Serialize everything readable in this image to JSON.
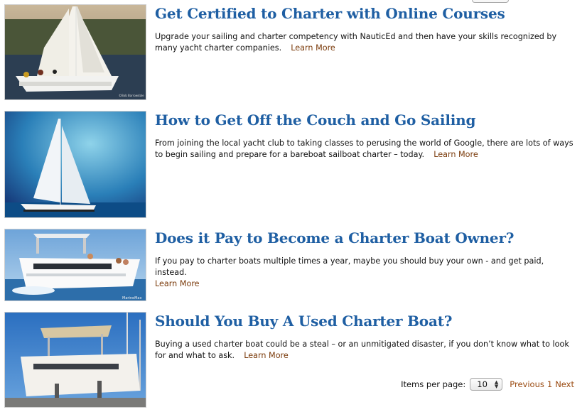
{
  "articles": [
    {
      "title": "Get Certified to Charter with Online Courses",
      "description": "Upgrade your sailing and charter competency with NauticEd and then have your skills recognized by many yacht charter companies.",
      "learn_more": "Learn More",
      "photo_credit": "©Bob Barrowdale"
    },
    {
      "title": "How to Get Off the Couch and Go Sailing",
      "description": "From joining the local yacht club to taking classes to perusing the world of Google, there are lots of ways to begin sailing and prepare for a bareboat sailboat charter – today.",
      "learn_more": "Learn More"
    },
    {
      "title": "Does it Pay to Become a Charter Boat Owner?",
      "description": "If you pay to charter boats multiple times a year, maybe you should buy your own - and get paid, instead.",
      "learn_more": "Learn More",
      "photo_credit": "MarineMax"
    },
    {
      "title": "Should You Buy A Used Charter Boat?",
      "description": "Buying a used charter boat could be a steal – or an unmitigated disaster, if you don’t know what to look for and what to ask.",
      "learn_more": "Learn More"
    }
  ],
  "pager": {
    "items_per_page_label": "Items per page:",
    "items_per_page_value": "10",
    "previous_label": "Previous",
    "current_page": "1",
    "next_label": "Next"
  },
  "colors": {
    "title": "#1f5fa3",
    "link": "#7a3a0a"
  }
}
